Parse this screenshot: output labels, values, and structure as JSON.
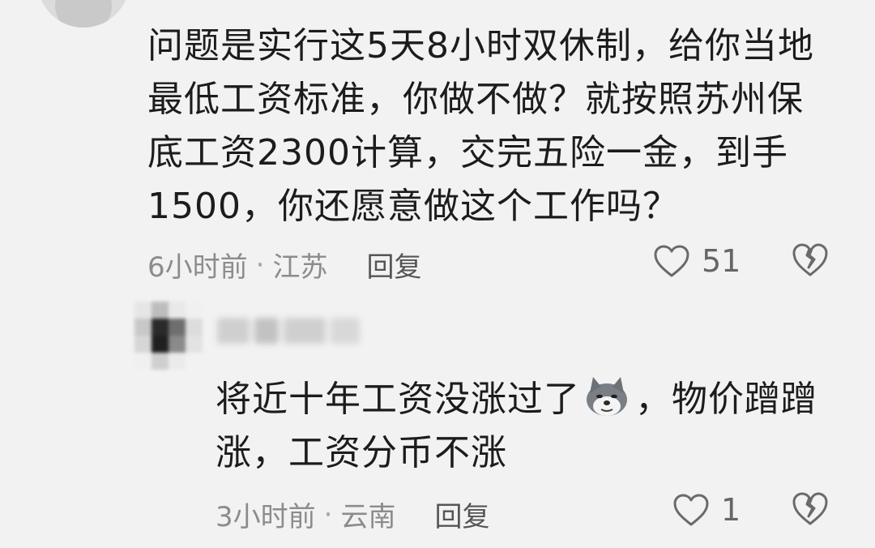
{
  "comments": [
    {
      "text": "问题是实行这5天8小时双休制，给你当地最低工资标准，你做不做？就按照苏州保底工资2300计算，交完五险一金，到手1500，你还愿意做这个工作吗？",
      "time": "6小时前",
      "location": "江苏",
      "reply_label": "回复",
      "like_count": "51",
      "icons": {
        "like": "heart-outline-icon",
        "dislike": "broken-heart-icon"
      }
    },
    {
      "text_before_emoji": "将近十年工资没涨过了",
      "emoji": "husky-dog-emoji",
      "text_after_emoji": "，物价蹭蹭涨，工资分币不涨",
      "time": "3小时前",
      "location": "云南",
      "reply_label": "回复",
      "like_count": "1",
      "icons": {
        "like": "heart-outline-icon",
        "dislike": "broken-heart-icon"
      }
    }
  ],
  "colors": {
    "background": "#f2f2f2",
    "text": "#1c1c1c",
    "meta": "#8c8c8c"
  }
}
